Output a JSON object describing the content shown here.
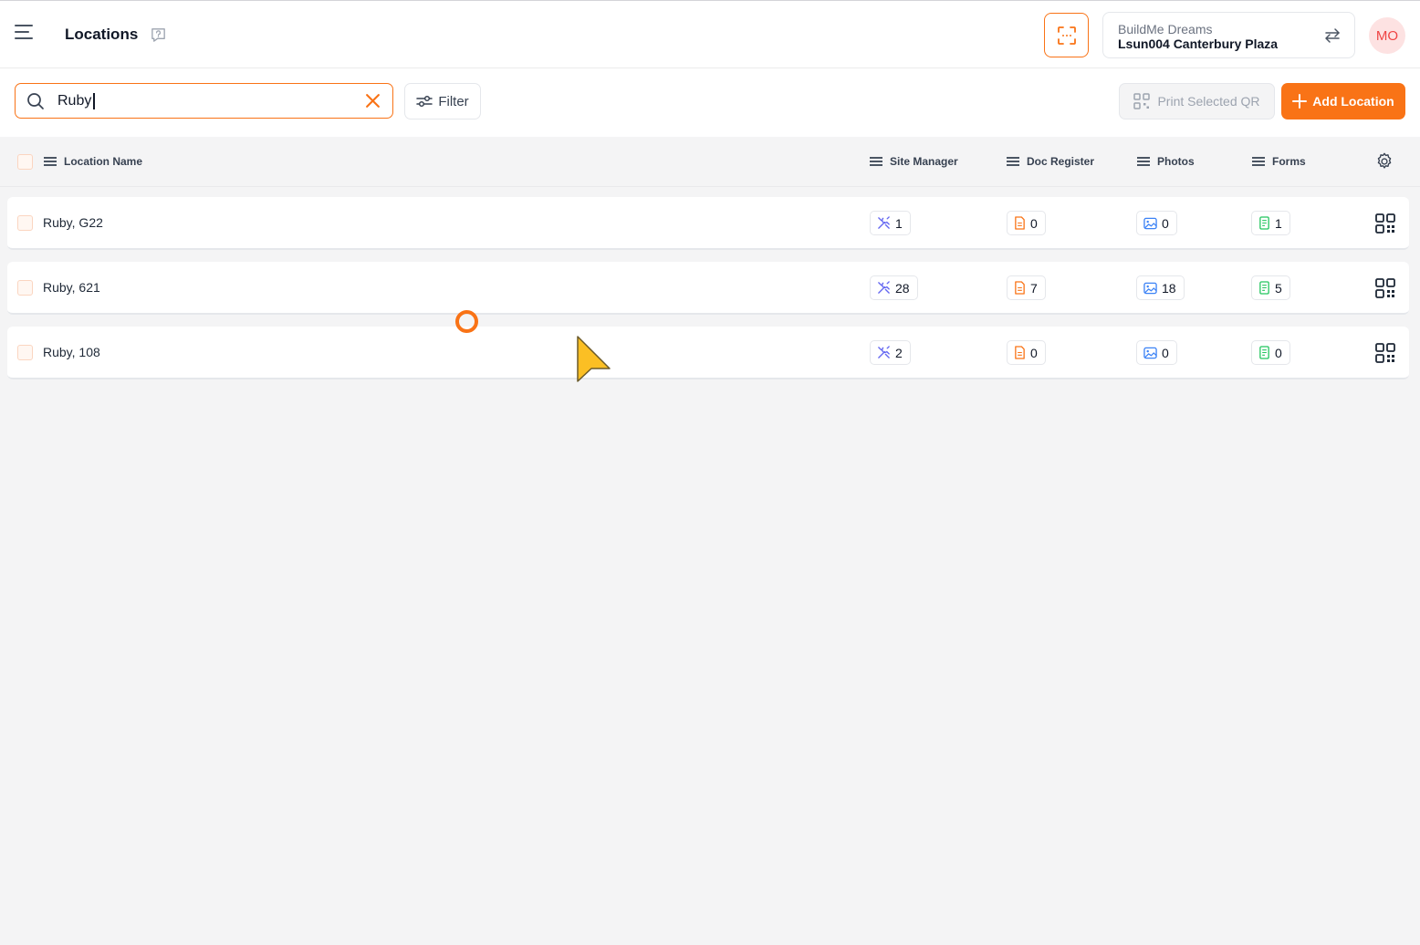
{
  "header": {
    "title": "Locations",
    "project_org": "BuildMe Dreams",
    "project_name": "Lsun004 Canterbury Plaza",
    "avatar_initials": "MO"
  },
  "toolbar": {
    "search_value": "Ruby",
    "filter_label": "Filter",
    "print_label": "Print Selected QR",
    "add_label": "Add Location"
  },
  "table": {
    "columns": {
      "location_name": "Location Name",
      "site_manager": "Site Manager",
      "doc_register": "Doc Register",
      "photos": "Photos",
      "forms": "Forms"
    },
    "rows": [
      {
        "name": "Ruby, G22",
        "site_manager": "1",
        "doc_register": "0",
        "photos": "0",
        "forms": "1"
      },
      {
        "name": "Ruby, 621",
        "site_manager": "28",
        "doc_register": "7",
        "photos": "18",
        "forms": "5"
      },
      {
        "name": "Ruby, 108",
        "site_manager": "2",
        "doc_register": "0",
        "photos": "0",
        "forms": "0"
      }
    ]
  },
  "colors": {
    "accent": "#f97316",
    "site_manager_icon": "#6366f1",
    "doc_register_icon": "#f97316",
    "photos_icon": "#3b82f6",
    "forms_icon": "#22c55e"
  },
  "icons": {
    "menu": "hamburger-icon",
    "help": "help-icon",
    "scan": "scan-icon",
    "swap": "swap-icon",
    "search": "search-icon",
    "clear": "close-icon",
    "filter": "sliders-icon",
    "print": "qr-code-icon",
    "add": "plus-icon",
    "settings": "gear-icon",
    "site_manager": "tools-icon",
    "doc_register": "document-icon",
    "photos": "image-icon",
    "forms": "form-icon",
    "row_qr": "qr-code-icon"
  }
}
